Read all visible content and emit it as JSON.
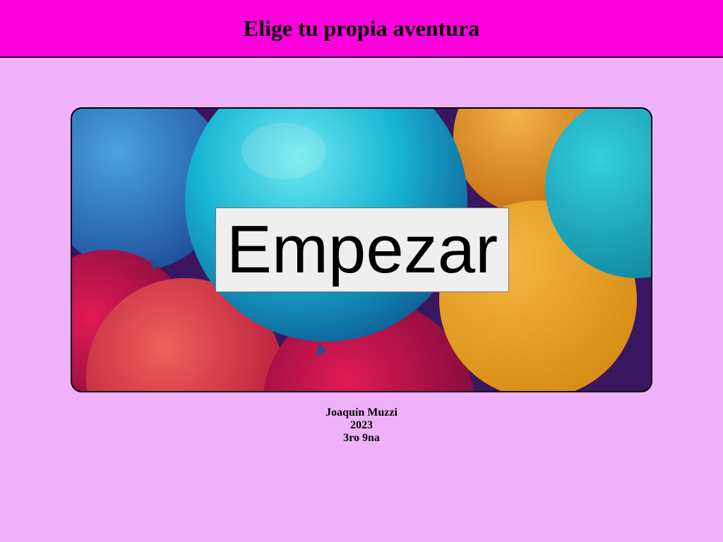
{
  "header": {
    "title": "Elige tu propia aventura"
  },
  "hero": {
    "image": "balloons-background",
    "start_label": "Empezar"
  },
  "footer": {
    "author": "Joaquín Muzzi",
    "year": "2023",
    "course": "3ro 9na"
  },
  "colors": {
    "page_background": "#f0b1fb",
    "header_background": "#ff00dd",
    "button_background": "#efefef"
  }
}
